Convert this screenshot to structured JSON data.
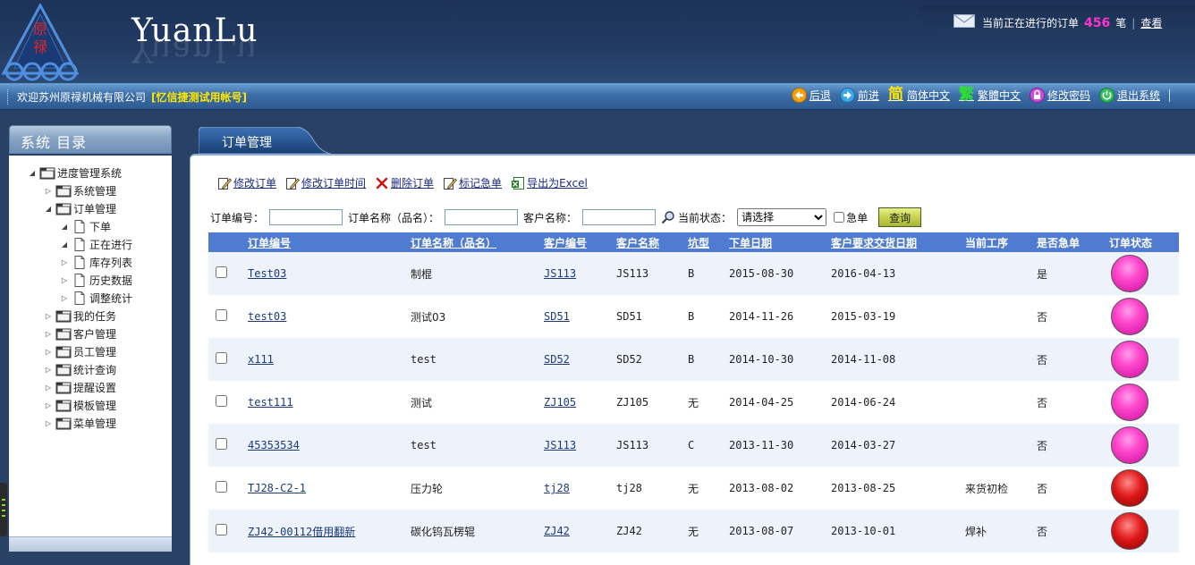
{
  "header": {
    "brand": "YuanLu",
    "logo_chars": "原禄",
    "notice": {
      "prefix": "当前正在进行的订单",
      "count": "456",
      "suffix": "笔",
      "view_link": "查看"
    }
  },
  "toolbar": {
    "welcome": "欢迎苏州原禄机械有限公司",
    "account": "[忆信捷测试用帐号]",
    "nav": {
      "back": "后退",
      "forward": "前进",
      "simplified_glyph": "简",
      "simplified": "简体中文",
      "traditional_glyph": "繁",
      "traditional": "繁體中文",
      "change_password": "修改密码",
      "logout": "退出系统"
    }
  },
  "sidebar": {
    "title": "系统 目录",
    "items": [
      {
        "label": "进度管理系统",
        "toggle": "◢"
      },
      {
        "label": "系统管理",
        "toggle": "▷"
      },
      {
        "label": "订单管理",
        "toggle": "◢"
      },
      {
        "label": "下单",
        "toggle": "◢"
      },
      {
        "label": "正在进行",
        "toggle": "◢"
      },
      {
        "label": "库存列表",
        "toggle": "▷"
      },
      {
        "label": "历史数据",
        "toggle": "▷"
      },
      {
        "label": "调整统计",
        "toggle": "▷"
      },
      {
        "label": "我的任务",
        "toggle": "▷"
      },
      {
        "label": "客户管理",
        "toggle": "▷"
      },
      {
        "label": "员工管理",
        "toggle": "▷"
      },
      {
        "label": "统计查询",
        "toggle": "▷"
      },
      {
        "label": "提醒设置",
        "toggle": "▷"
      },
      {
        "label": "模板管理",
        "toggle": "▷"
      },
      {
        "label": "菜单管理",
        "toggle": "▷"
      }
    ]
  },
  "main": {
    "tab": "订单管理",
    "actions": {
      "edit_order": "修改订单",
      "edit_time": "修改订单时间",
      "delete_order": "删除订单",
      "mark_urgent": "标记急单",
      "export_excel": "导出为Excel"
    },
    "search": {
      "order_no_label": "订单编号：",
      "order_name_label": "订单名称（品名）：",
      "customer_name_label": "客户名称：",
      "status_label": "当前状态：",
      "status_selected": "请选择",
      "urgent_label": "急单",
      "query_button": "查询"
    },
    "table": {
      "headers": {
        "order_no": "订单编号",
        "order_name": "订单名称（品名）",
        "customer_no": "客户编号",
        "customer_name": "客户名称",
        "groove": "坑型",
        "order_date": "下单日期",
        "delivery_date": "客户要求交货日期",
        "process": "当前工序",
        "urgent": "是否急单",
        "status": "订单状态"
      },
      "rows": [
        {
          "order_no": "Test03",
          "name": "制棍",
          "cust_no": "JS113",
          "cust_name": "JS113",
          "groove": "B",
          "order_date": "2015-08-30",
          "delivery": "2016-04-13",
          "process": "",
          "urgent": "是",
          "status": "pink"
        },
        {
          "order_no": "test03",
          "name": "测试03",
          "cust_no": "SD51",
          "cust_name": "SD51",
          "groove": "B",
          "order_date": "2014-11-26",
          "delivery": "2015-03-19",
          "process": "",
          "urgent": "否",
          "status": "pink"
        },
        {
          "order_no": "x111",
          "name": "test",
          "cust_no": "SD52",
          "cust_name": "SD52",
          "groove": "B",
          "order_date": "2014-10-30",
          "delivery": "2014-11-08",
          "process": "",
          "urgent": "否",
          "status": "pink"
        },
        {
          "order_no": "test111",
          "name": "测试",
          "cust_no": "ZJ105",
          "cust_name": "ZJ105",
          "groove": "无",
          "order_date": "2014-04-25",
          "delivery": "2014-06-24",
          "process": "",
          "urgent": "否",
          "status": "pink"
        },
        {
          "order_no": "45353534",
          "name": "test",
          "cust_no": "JS113",
          "cust_name": "JS113",
          "groove": "C",
          "order_date": "2013-11-30",
          "delivery": "2014-03-27",
          "process": "",
          "urgent": "否",
          "status": "pink"
        },
        {
          "order_no": "TJ28-C2-1",
          "name": "压力轮",
          "cust_no": "tj28",
          "cust_name": "tj28",
          "groove": "无",
          "order_date": "2013-08-02",
          "delivery": "2013-08-25",
          "process": "来货初检",
          "urgent": "否",
          "status": "red"
        },
        {
          "order_no": "ZJ42-00112借用翻新",
          "name": "碳化钨瓦楞辊",
          "cust_no": "ZJ42",
          "cust_name": "ZJ42",
          "groove": "无",
          "order_date": "2013-08-07",
          "delivery": "2013-10-01",
          "process": "焊补",
          "urgent": "否",
          "status": "red"
        }
      ]
    }
  },
  "colors": {
    "header_bg": "#1c3257",
    "table_header": "#4f7bd0",
    "status_pink": "#ff44cc",
    "status_red": "#e01818",
    "notice_count": "#ff33cc",
    "account": "#ffe600"
  }
}
